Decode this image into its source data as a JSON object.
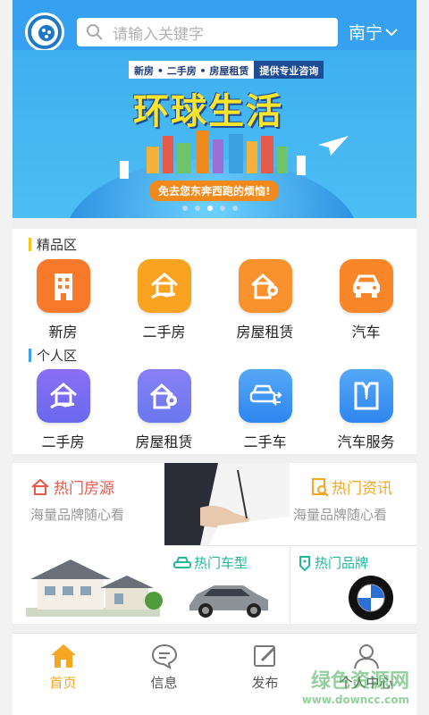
{
  "header": {
    "search_placeholder": "请输入关键字",
    "city": "南宁"
  },
  "banner": {
    "tag_left": "新房 • 二手房 • 房屋租赁",
    "tag_right": "提供专业咨询",
    "title": "环球生活",
    "slogan": "免去您东奔西跑的烦恼!",
    "dot_count": 5,
    "active_dot": 2
  },
  "sections": {
    "premium": {
      "title": "精品区",
      "items": [
        {
          "label": "新房",
          "icon": "building-icon",
          "color": "#f9792a"
        },
        {
          "label": "二手房",
          "icon": "house-hand-icon",
          "color": "#f9a321"
        },
        {
          "label": "房屋租赁",
          "icon": "house-key-icon",
          "color": "#f9922c"
        },
        {
          "label": "汽车",
          "icon": "car-icon",
          "color": "#f9872a"
        }
      ]
    },
    "personal": {
      "title": "个人区",
      "items": [
        {
          "label": "二手房",
          "icon": "house-hand-icon",
          "color": "#7a6ff0"
        },
        {
          "label": "房屋租赁",
          "icon": "house-key-icon",
          "color": "#7a7ef0"
        },
        {
          "label": "二手车",
          "icon": "car-swap-icon",
          "color": "#3f8ff2"
        },
        {
          "label": "汽车服务",
          "icon": "suit-icon",
          "color": "#3f8ff2"
        }
      ]
    }
  },
  "hot": {
    "houses": {
      "title": "热门房源",
      "subtitle": "海量品牌随心看"
    },
    "news": {
      "title": "热门资讯",
      "subtitle": "海量品牌随心看"
    },
    "car_models": {
      "title": "热门车型"
    },
    "brands": {
      "title": "热门品牌"
    }
  },
  "tabbar": [
    {
      "label": "首页",
      "icon": "home-icon",
      "active": true
    },
    {
      "label": "信息",
      "icon": "message-icon",
      "active": false
    },
    {
      "label": "发布",
      "icon": "edit-icon",
      "active": false
    },
    {
      "label": "个人中心",
      "icon": "user-icon",
      "active": false
    }
  ],
  "watermark": {
    "text": "绿色资源网",
    "url": "www.downcc.com"
  },
  "colors": {
    "primary": "#35a1f0",
    "active_tab": "#f5a623",
    "hot_house": "#e8584a",
    "hot_news": "#f5a623",
    "hot_green": "#20b89a"
  }
}
